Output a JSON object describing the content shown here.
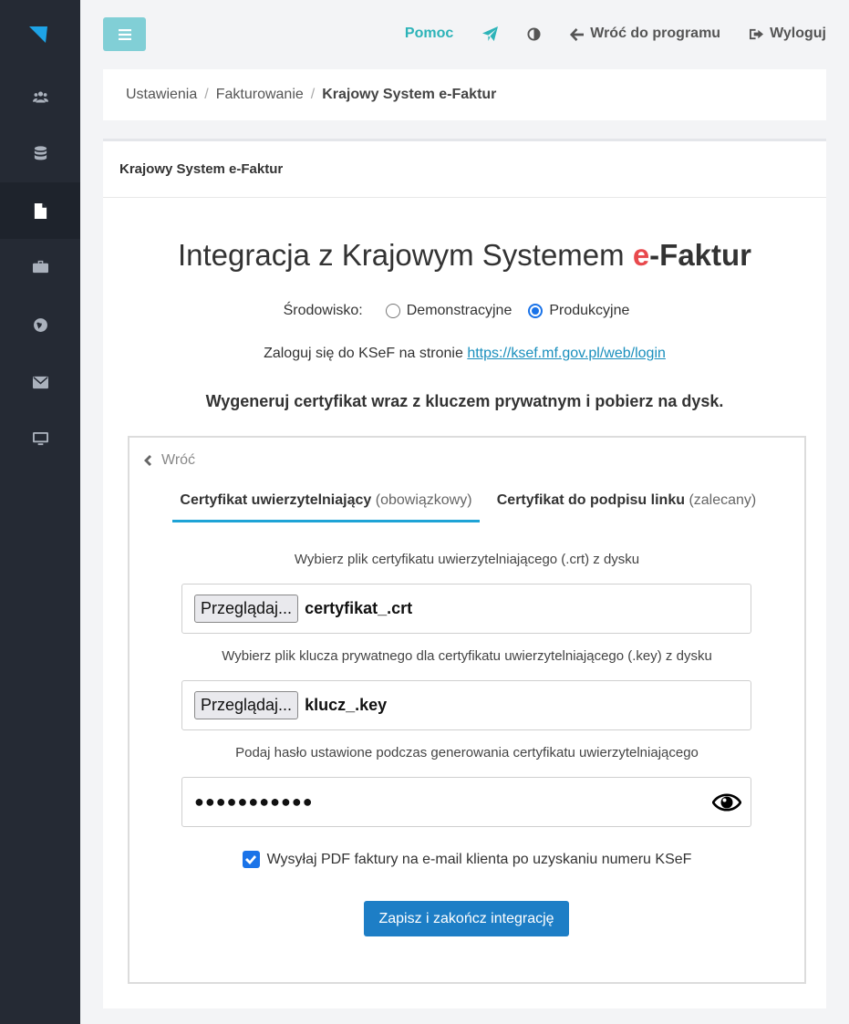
{
  "topbar": {
    "help_label": "Pomoc",
    "back_label": "Wróć do programu",
    "logout_label": "Wyloguj"
  },
  "sidebar": {
    "items": [
      {
        "icon": "users-icon"
      },
      {
        "icon": "database-icon"
      },
      {
        "icon": "file-icon",
        "active": true
      },
      {
        "icon": "briefcase-icon"
      },
      {
        "icon": "globe-icon"
      },
      {
        "icon": "envelope-icon"
      },
      {
        "icon": "monitor-icon"
      }
    ]
  },
  "breadcrumb": {
    "items": [
      "Ustawienia",
      "Fakturowanie",
      "Krajowy System e-Faktur"
    ]
  },
  "card": {
    "header": "Krajowy System e-Faktur",
    "title_prefix": "Integracja z Krajowym Systemem ",
    "title_e": "e",
    "title_suffix": "-Faktur",
    "env_label": "Środowisko:",
    "env_options": [
      "Demonstracyjne",
      "Produkcyjne"
    ],
    "env_selected": "Produkcyjne",
    "login_text": "Zaloguj się do KSeF na stronie ",
    "login_url": "https://ksef.mf.gov.pl/web/login",
    "generate_text": "Wygeneruj certyfikat wraz z kluczem prywatnym i pobierz na dysk."
  },
  "wizard": {
    "back_label": "Wróć",
    "tabs": [
      {
        "title": "Certyfikat uwierzytelniający",
        "note": "(obowiązkowy)",
        "active": true
      },
      {
        "title": "Certyfikat do podpisu linku",
        "note": "(zalecany)",
        "active": false
      }
    ],
    "cert_label": "Wybierz plik certyfikatu uwierzytelniającego (.crt) z dysku",
    "browse_label": "Przeglądaj...",
    "cert_file": "certyfikat_.crt",
    "key_label": "Wybierz plik klucza prywatnego dla certyfikatu uwierzytelniającego (.key) z dysku",
    "key_file": "klucz_.key",
    "password_label": "Podaj hasło ustawione podczas generowania certyfikatu uwierzytelniającego",
    "password_value": "●●●●●●●●●●●",
    "send_pdf_label": "Wysyłaj PDF faktury na e-mail klienta po uzyskaniu numeru KSeF",
    "send_pdf_checked": true,
    "submit_label": "Zapisz i zakończ integrację"
  },
  "colors": {
    "accent": "#2cb3b8",
    "primary": "#1d7ec6",
    "e_red": "#e8494d",
    "sidebar": "#252a34"
  }
}
